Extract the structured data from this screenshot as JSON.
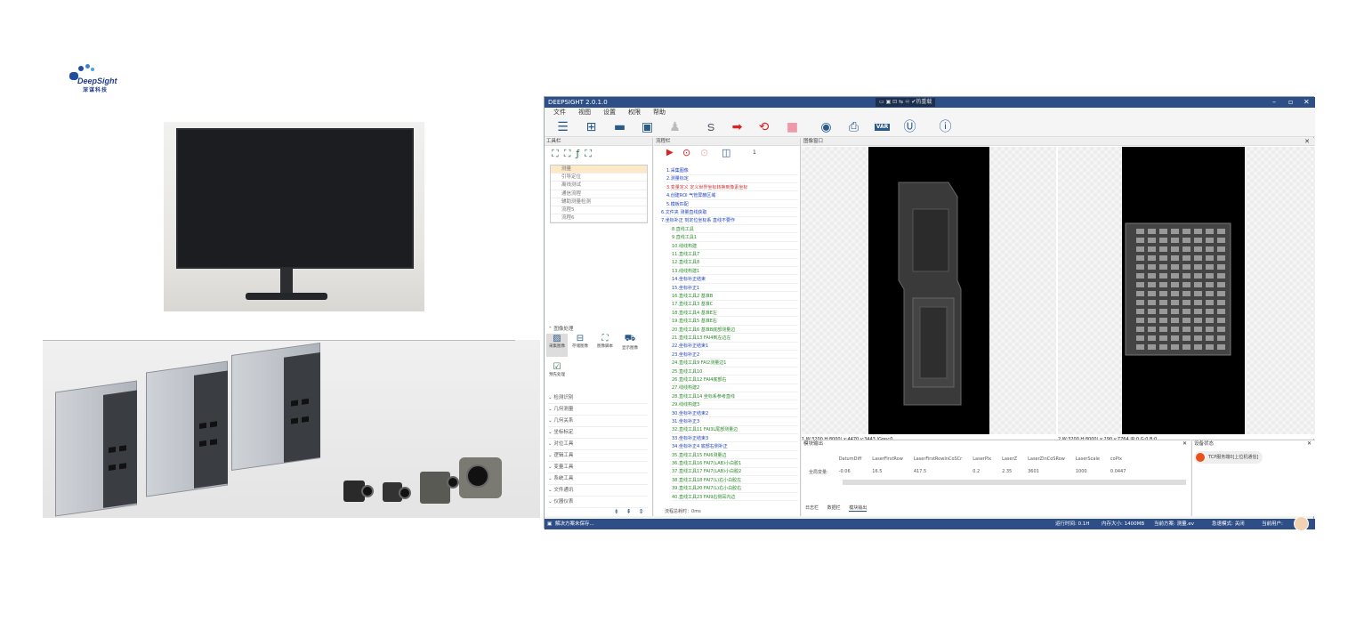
{
  "logo": {
    "text": "DeepSight",
    "cn": "深谋科技"
  },
  "photos": {
    "monitor": "monitor-photo",
    "ipc": "industrial-pc-and-cameras-photo"
  },
  "app": {
    "title": "DEEPSIGHT 2.0.1.0",
    "center_status": "热重载",
    "menu": [
      "文件",
      "视图",
      "设置",
      "权限",
      "帮助"
    ],
    "toolbar_icons": [
      "list-icon",
      "new-icon",
      "open-icon",
      "save-icon",
      "user-icon",
      "s-icon",
      "run-icon",
      "loop-icon",
      "stop-icon",
      "camera-icon",
      "print-icon",
      "var-icon",
      "ui-icon",
      "info-icon"
    ],
    "tools_panel": {
      "title": "工具栏",
      "flows": [
        "测量",
        "引导定位",
        "离线测试",
        "通信流程",
        "辅助测量检测",
        "流程5",
        "流程6"
      ],
      "section_title": "图像处理",
      "image_tools": [
        "采集图像",
        "存储图像",
        "图像脚本",
        "显示图像"
      ],
      "extra_tool": "预先处理",
      "categories": [
        "检测识别",
        "几何测量",
        "几何关系",
        "坐标标定",
        "对位工具",
        "逻辑工具",
        "变量工具",
        "系统工具",
        "文件通讯",
        "仪器仪表"
      ]
    },
    "process_panel": {
      "title": "流程栏",
      "count": "1",
      "steps": [
        {
          "t": "1.采集图像",
          "c": "blue"
        },
        {
          "t": "2.测量标定",
          "c": "blue"
        },
        {
          "t": "3.变量定义  定义世界坐标转换到像素坐标",
          "c": "red"
        },
        {
          "t": "4.创建ROI  气管屏蔽区域",
          "c": "blue"
        },
        {
          "t": "5.模板匹配",
          "c": "blue"
        },
        {
          "t": "6.文件夹  测量直线获取",
          "c": "blue"
        },
        {
          "t": "7.坐标补正  刻定位坐标系 直线不要作",
          "c": "blue"
        },
        {
          "t": "8.直线工具",
          "c": "green"
        },
        {
          "t": "9.直线工具1",
          "c": "green"
        },
        {
          "t": "10.线线构建",
          "c": "green"
        },
        {
          "t": "11.直线工具7",
          "c": "green"
        },
        {
          "t": "12.直线工具8",
          "c": "green"
        },
        {
          "t": "13.线线构建1",
          "c": "green"
        },
        {
          "t": "14.坐标补正结束",
          "c": "blue"
        },
        {
          "t": "15.坐标补正1",
          "c": "blue"
        },
        {
          "t": "16.直线工具2  基准B",
          "c": "green"
        },
        {
          "t": "17.直线工具3  基准C",
          "c": "green"
        },
        {
          "t": "18.直线工具4  基准E左",
          "c": "green"
        },
        {
          "t": "19.直线工具5  基准E右",
          "c": "green"
        },
        {
          "t": "20.直线工具6  基准B底部测量边",
          "c": "green"
        },
        {
          "t": "21.直线工具13  FAI4到左边左",
          "c": "green"
        },
        {
          "t": "22.坐标补正结束1",
          "c": "blue"
        },
        {
          "t": "23.坐标补正2",
          "c": "blue"
        },
        {
          "t": "24.直线工具9  FAI2测量边1",
          "c": "green"
        },
        {
          "t": "25.直线工具10",
          "c": "green"
        },
        {
          "t": "26.直线工具12  FAI4底部右",
          "c": "green"
        },
        {
          "t": "27.线线构建2",
          "c": "green"
        },
        {
          "t": "28.直线工具14  坐标系参考直线",
          "c": "green"
        },
        {
          "t": "29.线线构建3",
          "c": "green"
        },
        {
          "t": "30.坐标补正结束2",
          "c": "blue"
        },
        {
          "t": "31.坐标补正3",
          "c": "blue"
        },
        {
          "t": "32.直线工具11  FAI3L尾部测量边",
          "c": "green"
        },
        {
          "t": "33.坐标补正结束3",
          "c": "blue"
        },
        {
          "t": "34.坐标补正4  底部右侧补正",
          "c": "blue"
        },
        {
          "t": "35.直线工具15  FAI6测量边",
          "c": "green"
        },
        {
          "t": "36.直线工具16  FAI7(LAB)小白胶1",
          "c": "green"
        },
        {
          "t": "37.直线工具17  FAI7(LAB)小白胶2",
          "c": "green"
        },
        {
          "t": "38.直线工具18  FAI7(L)右小白胶左",
          "c": "green"
        },
        {
          "t": "39.直线工具20  FAI7(L)右小白胶右",
          "c": "green"
        },
        {
          "t": "40.直线工具23  FAI9右侧耳内边",
          "c": "green"
        }
      ],
      "total_time_label": "流程总耗时：",
      "total_time_value": "0ms"
    },
    "image_window": {
      "title": "图像窗口",
      "view1_status": "1  W:3200 H:8000| x:4470,y:3443 |Grey:0",
      "view2_status": "2  W:3200 H:8000| x:290,y:7764 |R:0,G:0,B:0"
    },
    "module_output": {
      "title": "模块输出",
      "headers": [
        "DatumDiff",
        "LaserFirstRow",
        "LaserFirstRowInCoSCr",
        "LaserPix",
        "LaserZ",
        "LaserZInCoSRow",
        "LaserScale",
        "coPix"
      ],
      "row_label": "全局变量:",
      "values": [
        "-0.06",
        "16.5",
        "417.5",
        "0.2",
        "2.35",
        "3601",
        "1000",
        "0.0447"
      ],
      "tabs": [
        "日志栏",
        "数据栏",
        "模块输出"
      ]
    },
    "device_status": {
      "title": "设备状态",
      "item": "TCP服务端0[上位机通信]"
    },
    "statusbar": {
      "left": "解决方案未保存...",
      "runtime": "运行时间: 0.1H",
      "memory": "内存大小: 1400MB",
      "solution": "当前方案: 测量.ev",
      "mode": "急速模式: 关闭",
      "user": "当前用户:"
    }
  }
}
